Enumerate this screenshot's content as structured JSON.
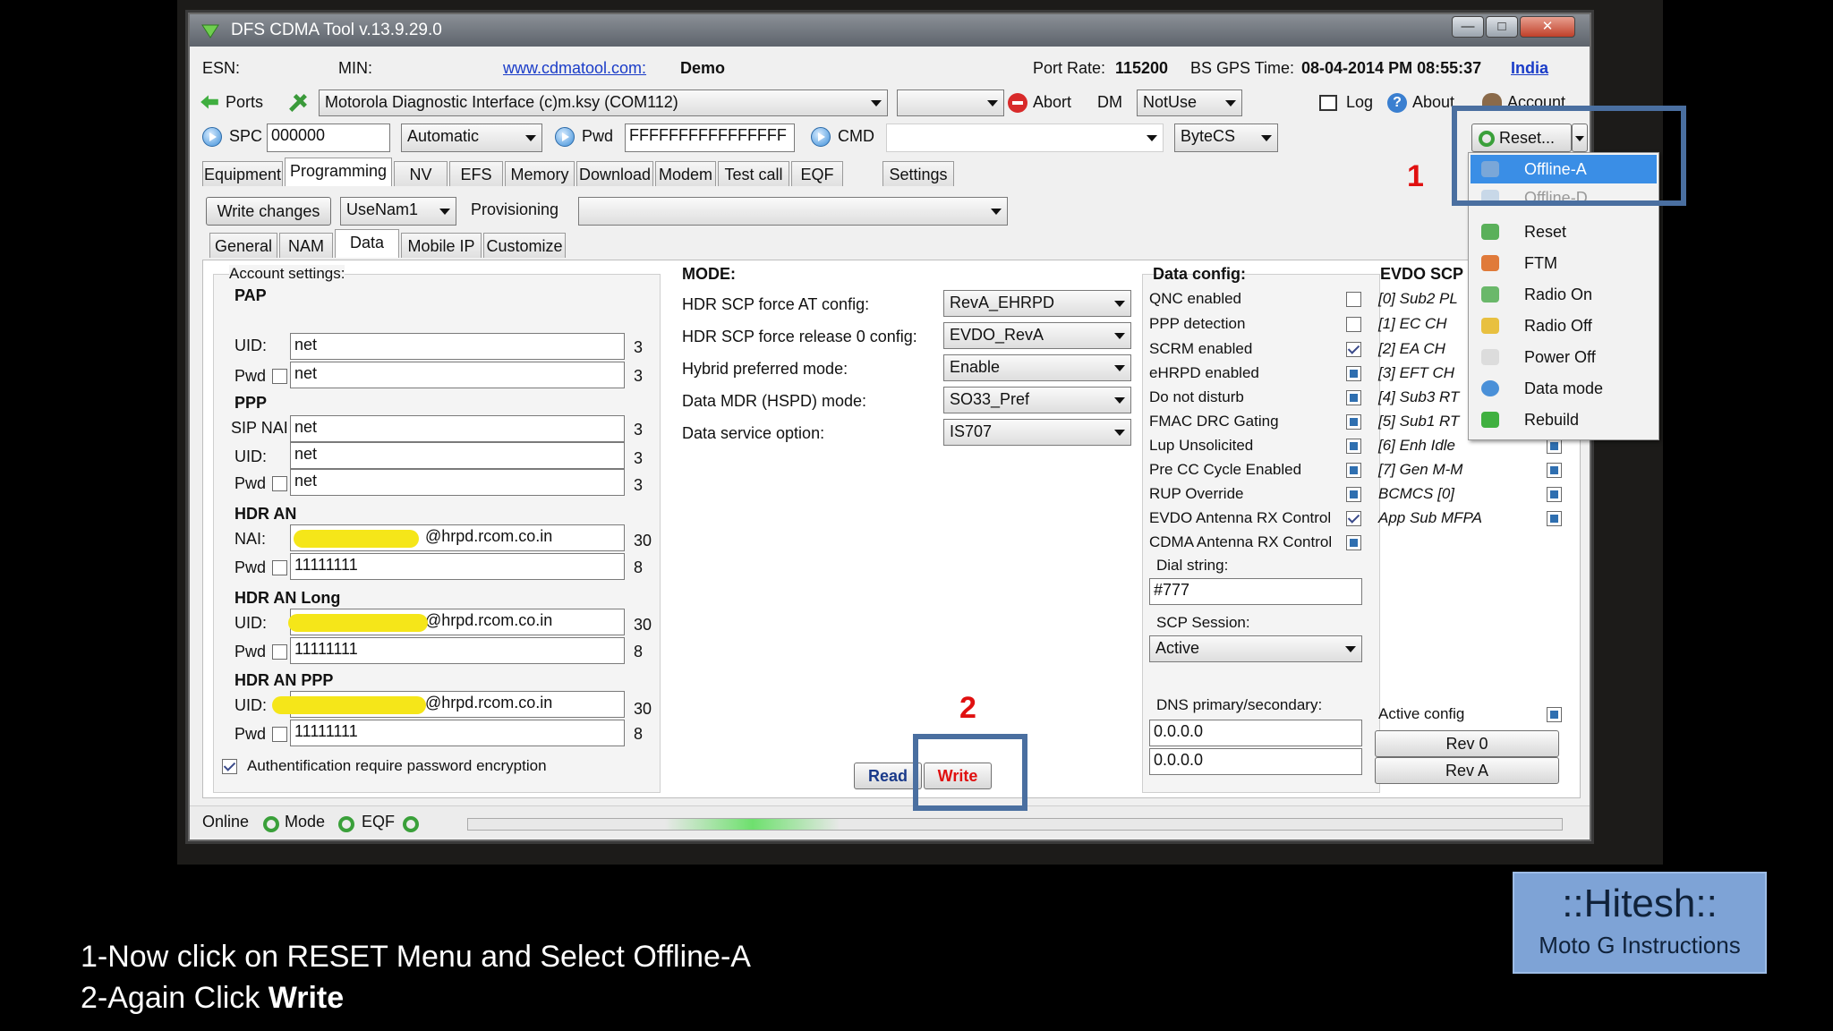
{
  "window": {
    "title": "DFS CDMA Tool v.13.9.29.0"
  },
  "info_row": {
    "esn_label": "ESN:",
    "min_label": "MIN:",
    "link": "www.cdmatool.com:",
    "demo": "Demo",
    "port_rate_label": "Port Rate:",
    "port_rate_value": "115200",
    "gps_label": "BS GPS Time:",
    "gps_value": "08-04-2014 PM 08:55:37",
    "region": "India"
  },
  "toolbar1": {
    "ports": "Ports",
    "interface": "Motorola Diagnostic Interface (c)m.ksy (COM112)",
    "abort": "Abort",
    "dm": "DM",
    "dm_value": "NotUse",
    "log": "Log",
    "about": "About",
    "account": "Account"
  },
  "toolbar2": {
    "spc_label": "SPC",
    "spc_value": "000000",
    "mode": "Automatic",
    "pwd_label": "Pwd",
    "pwd_value": "FFFFFFFFFFFFFFFF",
    "cmd_label": "CMD",
    "bytecs": "ByteCS",
    "reset": "Reset..."
  },
  "main_tabs": [
    "Equipment",
    "Programming",
    "NV",
    "EFS",
    "Memory",
    "Download",
    "Modem",
    "Test call",
    "EQF",
    "Settings"
  ],
  "prog_bar": {
    "write_changes": "Write changes",
    "nam": "UseNam1",
    "provisioning": "Provisioning"
  },
  "sub_tabs": [
    "General",
    "NAM",
    "Data",
    "Mobile IP",
    "Customize"
  ],
  "account": {
    "title": "Account settings:",
    "pap": "PAP",
    "ppp": "PPP",
    "hdr_an": "HDR AN",
    "hdr_an_long": "HDR AN Long",
    "hdr_an_ppp": "HDR AN PPP",
    "uid": "UID:",
    "pwd": "Pwd",
    "sip_nai": "SIP NAI",
    "nai": "NAI:",
    "pap_uid": "net",
    "pap_pwd": "net",
    "ppp_sip": "net",
    "ppp_uid": "net",
    "ppp_pwd": "net",
    "hdr_nai": "@hrpd.rcom.co.in",
    "hdr_pwd": "11111111",
    "long_uid": "@hrpd.rcom.co.in",
    "long_pwd": "11111111",
    "appp_uid": "@hrpd.rcom.co.in",
    "appp_pwd": "11111111",
    "len3": "3",
    "len30": "30",
    "len8": "8",
    "encrypt": "Authentification require password encryption"
  },
  "mode": {
    "title": "MODE:",
    "rows": [
      {
        "label": "HDR SCP force AT config:",
        "value": "RevA_EHRPD"
      },
      {
        "label": "HDR SCP force release 0 config:",
        "value": "EVDO_RevA"
      },
      {
        "label": "Hybrid preferred mode:",
        "value": "Enable"
      },
      {
        "label": "Data MDR (HSPD) mode:",
        "value": "SO33_Pref"
      },
      {
        "label": "Data service option:",
        "value": "IS707"
      }
    ],
    "read": "Read",
    "write": "Write"
  },
  "data_config": {
    "title": "Data config:",
    "items": [
      "QNC enabled",
      "PPP detection",
      "SCRM enabled",
      "eHRPD enabled",
      "Do not disturb",
      "FMAC DRC Gating",
      "Lup Unsolicited",
      "Pre CC Cycle Enabled",
      "RUP Override",
      "EVDO Antenna RX Control",
      "CDMA Antenna RX Control"
    ],
    "dial_label": "Dial string:",
    "dial_value": "#777",
    "scp_label": "SCP Session:",
    "scp_value": "Active",
    "dns_label": "DNS primary/secondary:",
    "dns1": "0.0.0.0",
    "dns2": "0.0.0.0"
  },
  "evdo": {
    "title": "EVDO SCP",
    "items": [
      "[0] Sub2 PL",
      "[1] EC CH",
      "[2] EA CH",
      "[3] EFT CH",
      "[4] Sub3 RT",
      "[5] Sub1 RT",
      "[6] Enh Idle",
      "[7] Gen M-M",
      "BCMCS [0]",
      "App Sub MFPA"
    ],
    "active_config": "Active config",
    "rev0": "Rev 0",
    "reva": "Rev A"
  },
  "reset_menu": [
    "Offline-A",
    "Offline-D",
    "Reset",
    "FTM",
    "Radio On",
    "Radio Off",
    "Power Off",
    "Data mode",
    "Rebuild"
  ],
  "status": {
    "online": "Online",
    "mode": "Mode",
    "eqf": "EQF"
  },
  "markers": {
    "one": "1",
    "two": "2"
  },
  "credit": {
    "title": "::Hitesh::",
    "subtitle": "Moto G Instructions"
  },
  "instructions": {
    "line1": "1-Now click on RESET Menu and Select Offline-A",
    "line2_prefix": "2-Again Click ",
    "line2_bold": "Write"
  }
}
